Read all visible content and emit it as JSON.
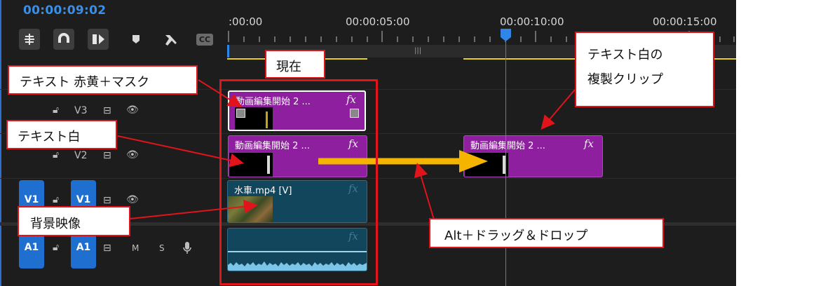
{
  "timeline": {
    "timecode": "00:00:09:02",
    "ruler_labels": [
      ":00:00",
      "00:00:05:00",
      "00:00:10:00",
      "00:00:15:00"
    ]
  },
  "toolbar": {
    "tools": [
      "insert-snap-icon",
      "magnet-icon",
      "linked-selection-icon",
      "marker-icon",
      "wrench-icon",
      "captions-icon"
    ],
    "captions_label": "CC"
  },
  "tracks": {
    "v3": {
      "label": "V3"
    },
    "v2": {
      "label": "V2"
    },
    "v1": {
      "source_label": "V1",
      "label": "V1"
    },
    "a1": {
      "source_label": "A1",
      "label": "A1",
      "mute": "M",
      "solo": "S"
    }
  },
  "clips": {
    "v3_clip": {
      "name": "動画編集開始 2 ...",
      "fx": "fx"
    },
    "v2_clip": {
      "name": "動画編集開始 2 ...",
      "fx": "fx"
    },
    "v2_copy": {
      "name": "動画編集開始 2 ...",
      "fx": "fx"
    },
    "v1_clip": {
      "name": "水車.mp4 [V]",
      "fx": "fx"
    },
    "a1_clip": {
      "fx": "fx"
    }
  },
  "annotations": {
    "current": "現在",
    "text_red_yellow_mask": "テキスト 赤黄＋マスク",
    "text_white": "テキスト白",
    "background_video": "背景映像",
    "duplicate_line1": "テキスト白の",
    "duplicate_line2": "複製クリップ",
    "alt_drag": "Alt＋ドラッグ＆ドロップ"
  },
  "colors": {
    "timecode": "#3a8fe8",
    "track_button": "#1f6fd1",
    "title_clip": "#8e1f9e",
    "video_clip": "#11465d",
    "callout_border": "#e0141a",
    "arrow": "#f4b400",
    "work_area": "#e8d21d",
    "playhead": "#2f86e6"
  }
}
